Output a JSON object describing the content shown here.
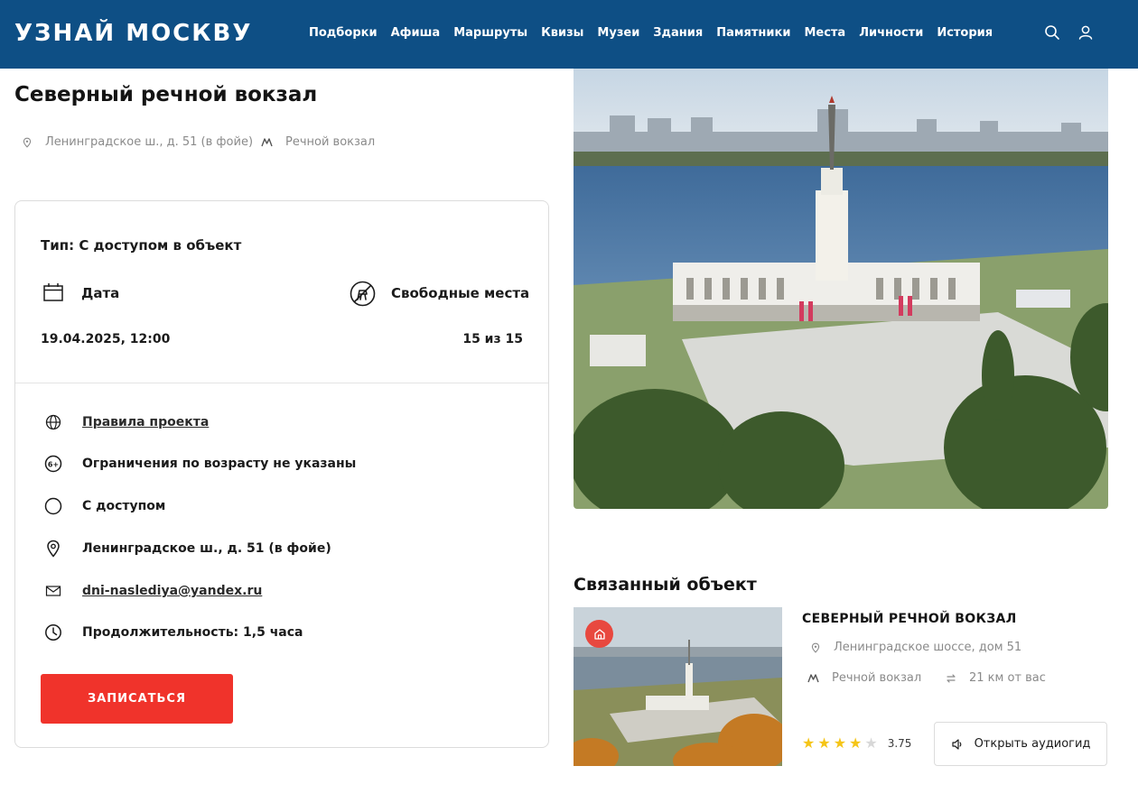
{
  "header": {
    "logo": "УЗНАЙ МОСКВУ",
    "nav": [
      "Подборки",
      "Афиша",
      "Маршруты",
      "Квизы",
      "Музеи",
      "Здания",
      "Памятники",
      "Места",
      "Личности",
      "История"
    ],
    "icons": [
      "search-icon",
      "user-icon"
    ],
    "bg_color": "#0e4f85"
  },
  "event": {
    "title": "Северный речной вокзал",
    "address": "Ленинградское ш., д. 51 (в фойе)",
    "metro": "Речной вокзал",
    "type_line": "Тип: С доступом в объект",
    "date_label": "Дата",
    "seats_label": "Свободные места",
    "date_value": "19.04.2025, 12:00",
    "seats_value": "15 из 15",
    "rules_link": "Правила проекта",
    "age_limit": "Ограничения по возрасту не указаны",
    "access": "С доступом",
    "full_address": "Ленинградское ш., д. 51 (в фойе)",
    "email": "dni-naslediya@yandex.ru",
    "duration": "Продолжительность: 1,5 часа",
    "signup_button": "ЗАПИСАТЬСЯ",
    "accent_color": "#f0332b"
  },
  "related": {
    "section_title": "Связанный объект",
    "name": "СЕВЕРНЫЙ РЕЧНОЙ ВОКЗАЛ",
    "address": "Ленинградское шоссе, дом 51",
    "metro": "Речной вокзал",
    "distance": "21 км от вас",
    "rating": "3.75",
    "stars_filled": 4,
    "stars_total": 5,
    "audio_button": "Открыть аудиогид"
  }
}
